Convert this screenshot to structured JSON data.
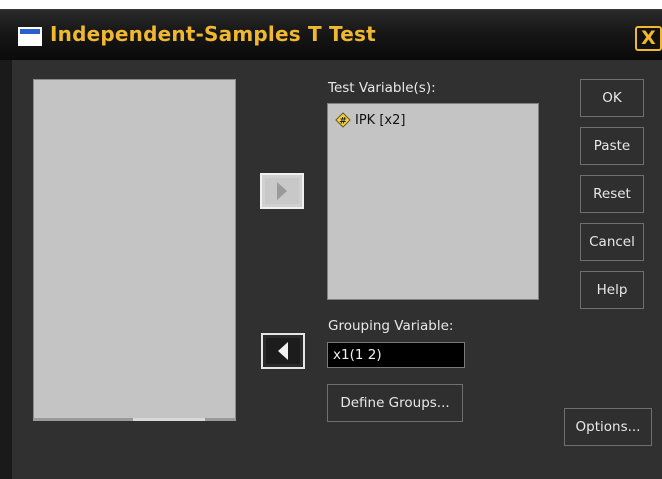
{
  "window": {
    "title": "Independent-Samples T Test",
    "close_glyph": "X",
    "title_color": "#f0b830"
  },
  "left_list": {
    "items": []
  },
  "test_variables": {
    "label": "Test Variable(s):",
    "items": [
      {
        "icon": "scale-variable-icon",
        "label": "IPK [x2]"
      }
    ]
  },
  "grouping": {
    "label": "Grouping Variable:",
    "value": "x1(1 2)",
    "define_groups_label": "Define Groups..."
  },
  "transfer": {
    "move_right_icon": "arrow-right-icon",
    "move_left_icon": "arrow-left-icon"
  },
  "buttons": {
    "ok": "OK",
    "paste": "Paste",
    "reset": "Reset",
    "cancel": "Cancel",
    "help": "Help",
    "options": "Options..."
  }
}
